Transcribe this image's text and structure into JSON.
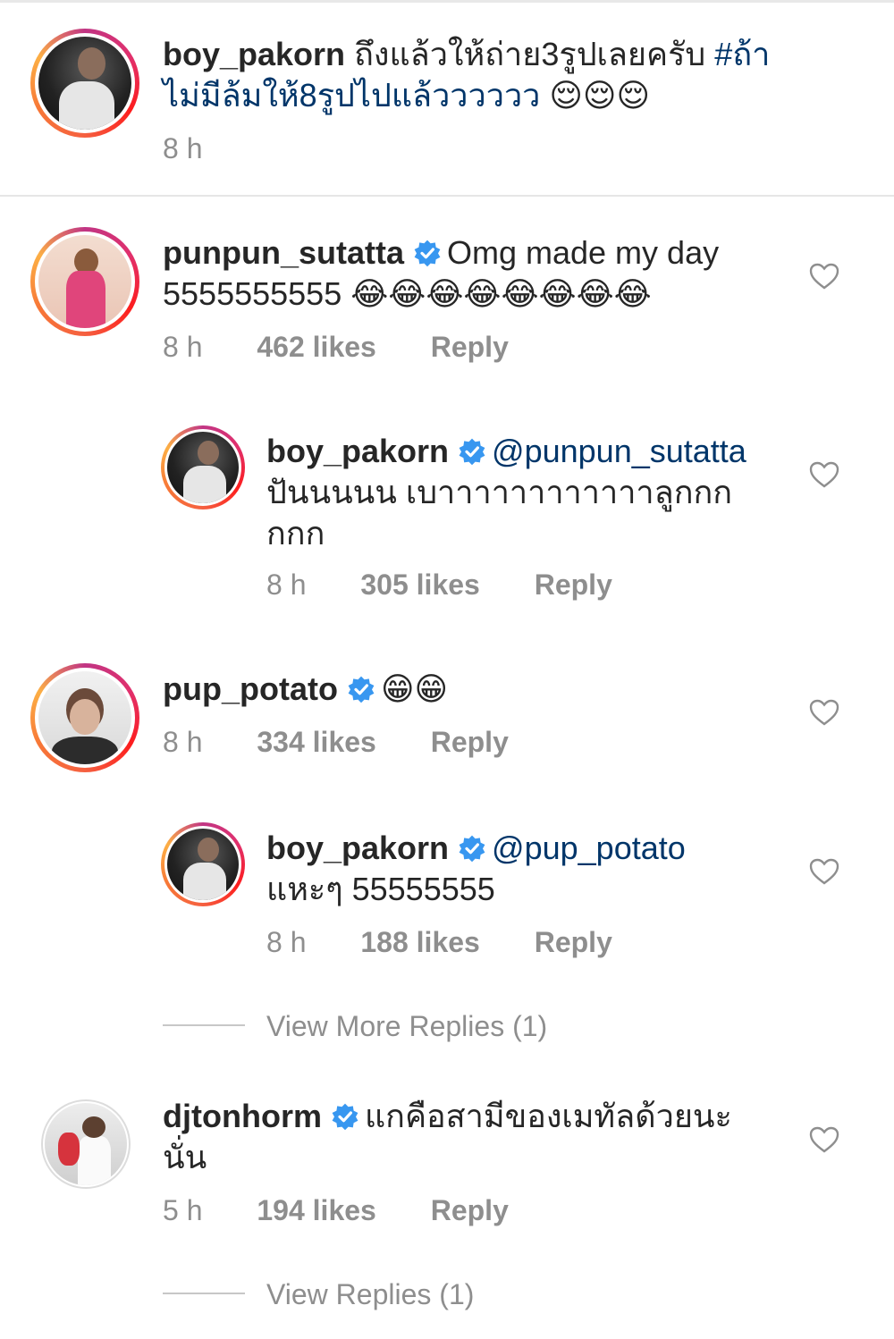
{
  "caption": {
    "username": "boy_pakorn",
    "text_line1": "ถึงแล้วให้ถ่าย3รูปเลยครับ",
    "hashtag_part1": "#ถ้า",
    "hashtag_part2": "ไม่มีล้มให้8รูปไปแล้วววววว",
    "emojis": "😌😌😌",
    "time": "8 h"
  },
  "comments": [
    {
      "username": "punpun_sutatta",
      "text": "Omg made my day",
      "text2": "5555555555",
      "emojis": "😂😂😂😂😂😂😂😂",
      "time": "8 h",
      "likes": "462 likes",
      "reply": "Reply",
      "reply_item": {
        "username": "boy_pakorn",
        "mention": "@punpun_sutatta",
        "text_line1": "ปันนนนน เบาาาาาาาาาาาาลูกกก",
        "text_line2": "กกก",
        "time": "8 h",
        "likes": "305 likes",
        "reply": "Reply"
      }
    },
    {
      "username": "pup_potato",
      "emojis": "😁😁",
      "time": "8 h",
      "likes": "334 likes",
      "reply": "Reply",
      "reply_item": {
        "username": "boy_pakorn",
        "mention": "@pup_potato",
        "text_line1": "แหะๆ 55555555",
        "time": "8 h",
        "likes": "188 likes",
        "reply": "Reply"
      },
      "more_replies": "View More Replies (1)"
    },
    {
      "username": "djtonhorm",
      "text_line1": "แกคือสามีของเมทัลด้วยนะ",
      "text_line2": "นั่น",
      "time": "5 h",
      "likes": "194 likes",
      "reply": "Reply",
      "more_replies": "View Replies (1)"
    }
  ],
  "colors": {
    "text": "#262626",
    "meta": "#8e8e8e",
    "hashtag": "#003569",
    "verified": "#3897f0"
  },
  "icons": [
    "verified-badge-icon",
    "heart-icon"
  ]
}
